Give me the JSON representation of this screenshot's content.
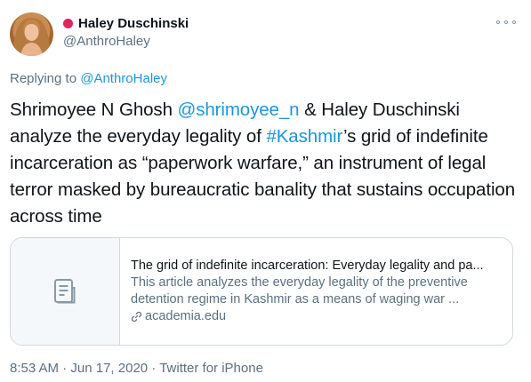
{
  "tweet": {
    "author": {
      "name": "Haley Duschinski",
      "handle": "@AnthroHaley",
      "status_color": "#e0245e"
    },
    "reply": {
      "prefix": "Replying to",
      "target": "@AnthroHaley"
    },
    "body": {
      "t1": "Shrimoyee N Ghosh ",
      "mention1": "@shrimoyee_n",
      "t2": " &  Haley Duschinski analyze the everyday legality of  ",
      "hashtag": "#Kashmir",
      "t3": "’s grid of indefinite incarceration as “paperwork warfare,” an instrument of legal terror masked by bureaucratic banality that sustains occupation across time"
    },
    "card": {
      "icon": "document-icon",
      "title": "The grid of indefinite incarceration: Everyday legality and pa...",
      "description": "This article analyzes the everyday legality of the preventive detention regime in Kashmir as a means of waging war ...",
      "domain": "academia.edu"
    },
    "meta": {
      "time": "8:53 AM",
      "sep1": " · ",
      "date": "Jun 17, 2020",
      "sep2": " · ",
      "source": "Twitter for iPhone"
    }
  },
  "colors": {
    "link": "#1b95e0",
    "secondary_text": "#5b7083",
    "border": "#cfd9de"
  }
}
